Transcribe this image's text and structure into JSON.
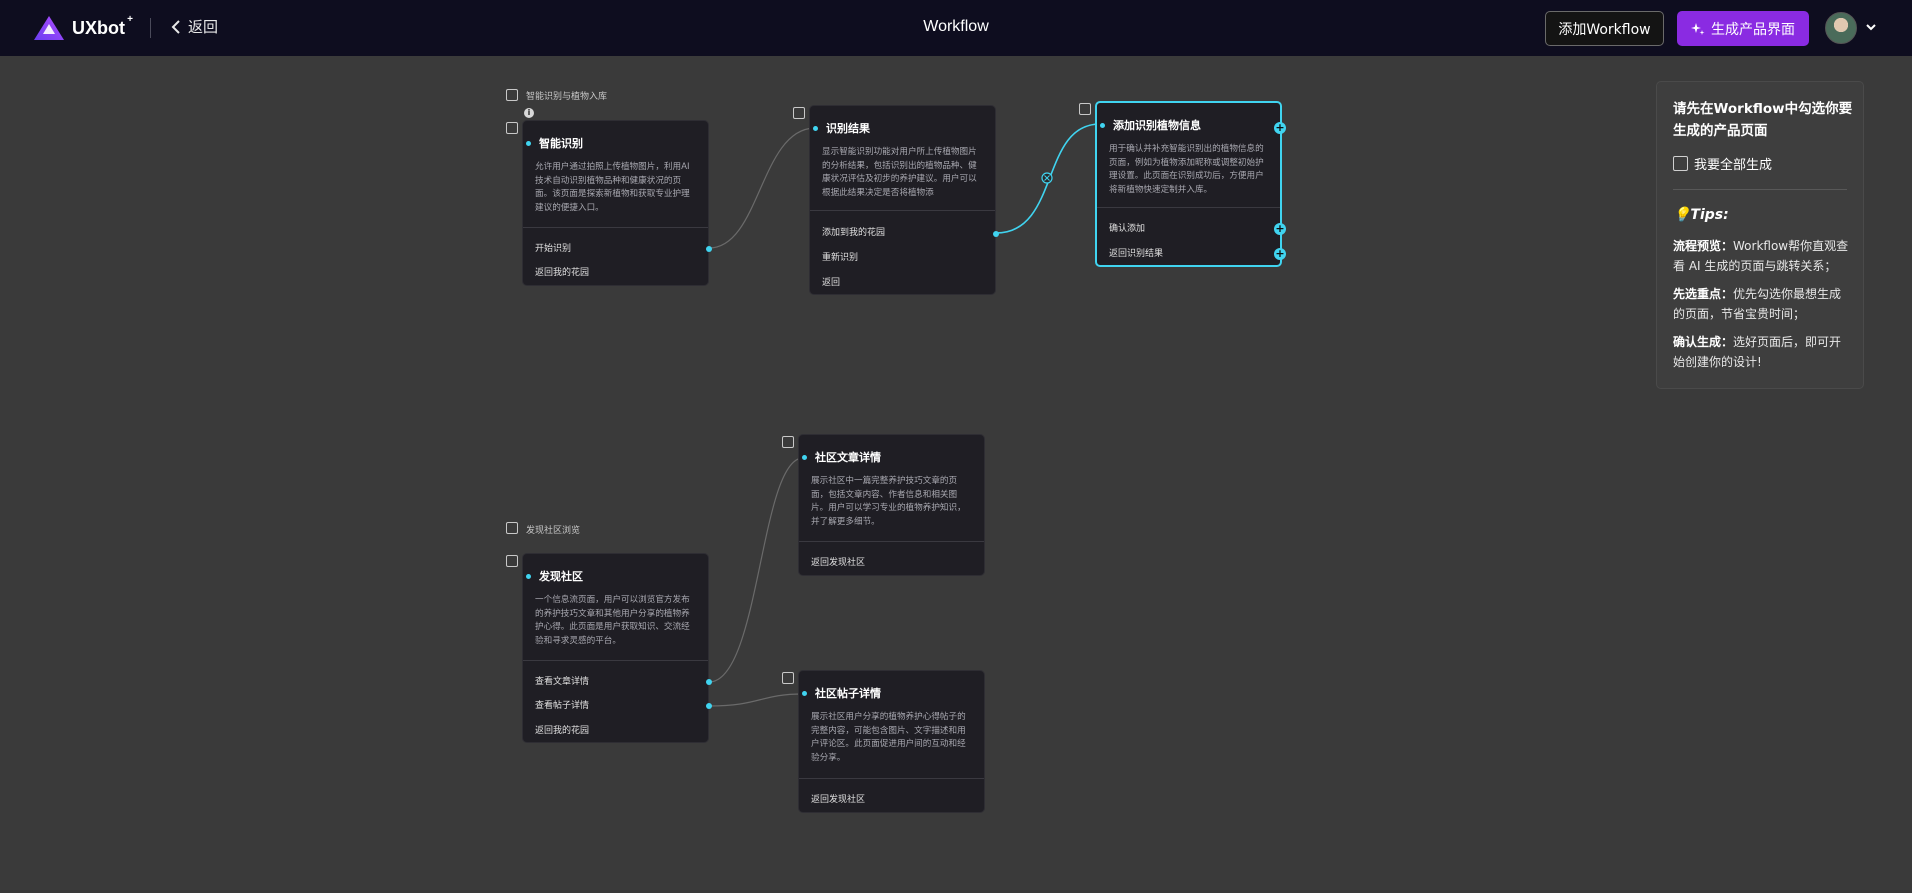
{
  "header": {
    "logo_text": "UXbot",
    "logo_sup": "+",
    "back_label": "返回",
    "title": "Workflow",
    "add_workflow_label": "添加Workflow",
    "generate_label": "生成产品界面"
  },
  "groups": {
    "group1_label": "智能识别与植物入库",
    "group2_label": "发现社区浏览"
  },
  "cards": {
    "smart_identify": {
      "title": "智能识别",
      "desc": "允许用户通过拍照上传植物图片，利用AI技术自动识别植物品种和健康状况的页面。该页面是探索新植物和获取专业护理建议的便捷入口。",
      "actions": [
        "开始识别",
        "返回我的花园"
      ]
    },
    "identify_result": {
      "title": "识别结果",
      "desc": "显示智能识别功能对用户所上传植物图片的分析结果，包括识别出的植物品种、健康状况评估及初步的养护建议。用户可以根据此结果决定是否将植物添",
      "actions": [
        "添加到我的花园",
        "重新识别",
        "返回"
      ]
    },
    "add_plant_info": {
      "title": "添加识别植物信息",
      "desc": "用于确认并补充智能识别出的植物信息的页面，例如为植物添加昵称或调整初始护理设置。此页面在识别成功后，方便用户将新植物快速定制并入库。",
      "actions": [
        "确认添加",
        "返回识别结果"
      ]
    },
    "community_article": {
      "title": "社区文章详情",
      "desc": "展示社区中一篇完整养护技巧文章的页面，包括文章内容、作者信息和相关图片。用户可以学习专业的植物养护知识，并了解更多细节。",
      "actions": [
        "返回发现社区"
      ]
    },
    "discover_community": {
      "title": "发现社区",
      "desc": "一个信息流页面，用户可以浏览官方发布的养护技巧文章和其他用户分享的植物养护心得。此页面是用户获取知识、交流经验和寻求灵感的平台。",
      "actions": [
        "查看文章详情",
        "查看帖子详情",
        "返回我的花园"
      ]
    },
    "community_post": {
      "title": "社区帖子详情",
      "desc": "展示社区用户分享的植物养护心得帖子的完整内容，可能包含图片、文字描述和用户评论区。此页面促进用户间的互动和经验分享。",
      "actions": [
        "返回发现社区"
      ]
    }
  },
  "tips_panel": {
    "heading": "请先在Workflow中勾选你要生成的产品页面",
    "select_all_label": "我要全部生成",
    "tips_title": "💡Tips:",
    "tips": [
      {
        "label": "流程预览：",
        "text": "Workflow帮你直观查看 AI 生成的页面与跳转关系；"
      },
      {
        "label": "先选重点：",
        "text": "优先勾选你最想生成的页面，节省宝贵时间；"
      },
      {
        "label": "确认生成：",
        "text": "选好页面后，即可开始创建你的设计!"
      }
    ]
  },
  "colors": {
    "accent": "#40d4f0",
    "brand": "#8a2be2",
    "topbar": "#0e0d1f",
    "canvas": "#3a3a3a",
    "card": "#1f1e24"
  }
}
